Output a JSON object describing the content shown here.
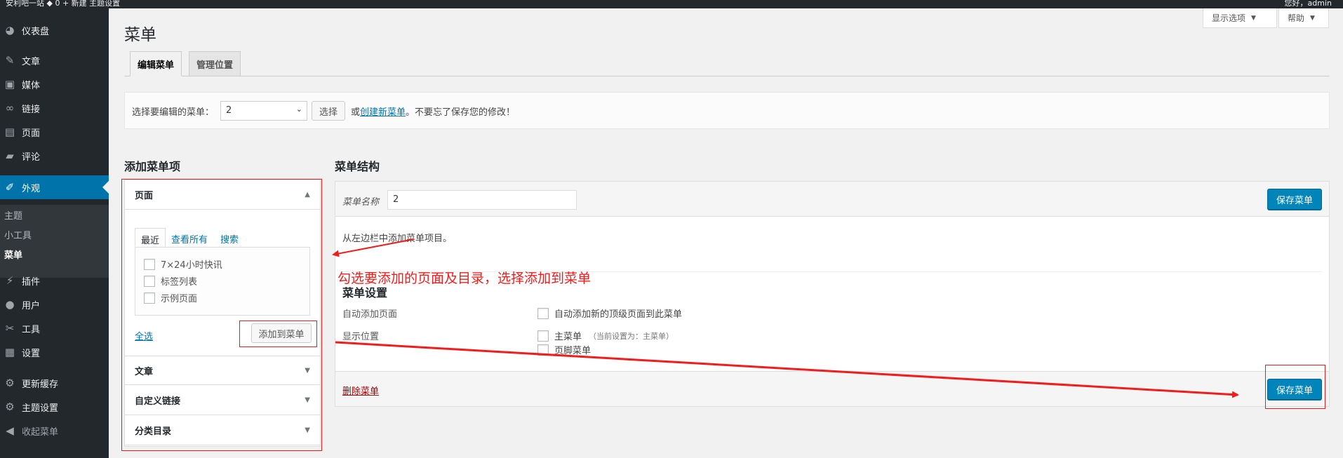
{
  "adminbar": {
    "left_text": "安利吧一站   ◆ 0   + 新建   主题设置",
    "right_text": "您好，admin"
  },
  "sidebar": {
    "items": [
      {
        "label": "仪表盘",
        "icon": "dashboard-icon",
        "glyph": "◕"
      },
      {
        "label": "文章",
        "icon": "pushpin-icon",
        "glyph": "✎"
      },
      {
        "label": "媒体",
        "icon": "media-icon",
        "glyph": "▣"
      },
      {
        "label": "链接",
        "icon": "link-icon",
        "glyph": "∞"
      },
      {
        "label": "页面",
        "icon": "page-icon",
        "glyph": "▤"
      },
      {
        "label": "评论",
        "icon": "comment-icon",
        "glyph": "▰"
      },
      {
        "label": "外观",
        "icon": "appearance-icon",
        "glyph": "✐"
      },
      {
        "label": "插件",
        "icon": "plugin-icon",
        "glyph": "⚡"
      },
      {
        "label": "用户",
        "icon": "user-icon",
        "glyph": "●"
      },
      {
        "label": "工具",
        "icon": "wrench-icon",
        "glyph": "✂"
      },
      {
        "label": "设置",
        "icon": "settings-icon",
        "glyph": "▦"
      },
      {
        "label": "更新缓存",
        "icon": "gear-icon",
        "glyph": "⚙"
      },
      {
        "label": "主题设置",
        "icon": "gear-icon",
        "glyph": "⚙"
      },
      {
        "label": "收起菜单",
        "icon": "collapse-icon",
        "glyph": "◀"
      }
    ],
    "submenu": [
      "主题",
      "小工具",
      "菜单"
    ]
  },
  "header": {
    "screen_options": "显示选项",
    "help": "帮助",
    "title": "菜单"
  },
  "tabs": [
    "编辑菜单",
    "管理位置"
  ],
  "manage": {
    "label": "选择要编辑的菜单：",
    "selected": "2",
    "select_button": "选择",
    "or_text": "或",
    "create_link": "创建新菜单",
    "reminder": "。不要忘了保存您的修改！"
  },
  "add_items": {
    "title": "添加菜单项",
    "sections": [
      "页面",
      "文章",
      "自定义链接",
      "分类目录"
    ],
    "inner_tabs": [
      "最近",
      "查看所有",
      "搜索"
    ],
    "pages": [
      "7×24小时快讯",
      "标签列表",
      "示例页面"
    ],
    "select_all": "全选",
    "add_button": "添加到菜单"
  },
  "structure": {
    "title": "菜单结构",
    "name_label": "菜单名称",
    "name_value": "2",
    "save_button": "保存菜单",
    "hint": "从左边栏中添加菜单项目。",
    "settings_title": "菜单设置",
    "auto_add_label": "自动添加页面",
    "auto_add_option": "自动添加新的顶级页面到此菜单",
    "location_label": "显示位置",
    "location_primary": "主菜单",
    "location_primary_note": "（当前设置为：主菜单）",
    "location_footer": "页脚菜单",
    "delete_link": "删除菜单"
  },
  "annotation": {
    "text": "勾选要添加的页面及目录，选择添加到菜单",
    "color": "#f01d1d"
  },
  "colors": {
    "sidebar_bg": "#23282d",
    "active_menu": "#0073aa",
    "primary_button": "#0085ba",
    "link": "#0073aa"
  }
}
